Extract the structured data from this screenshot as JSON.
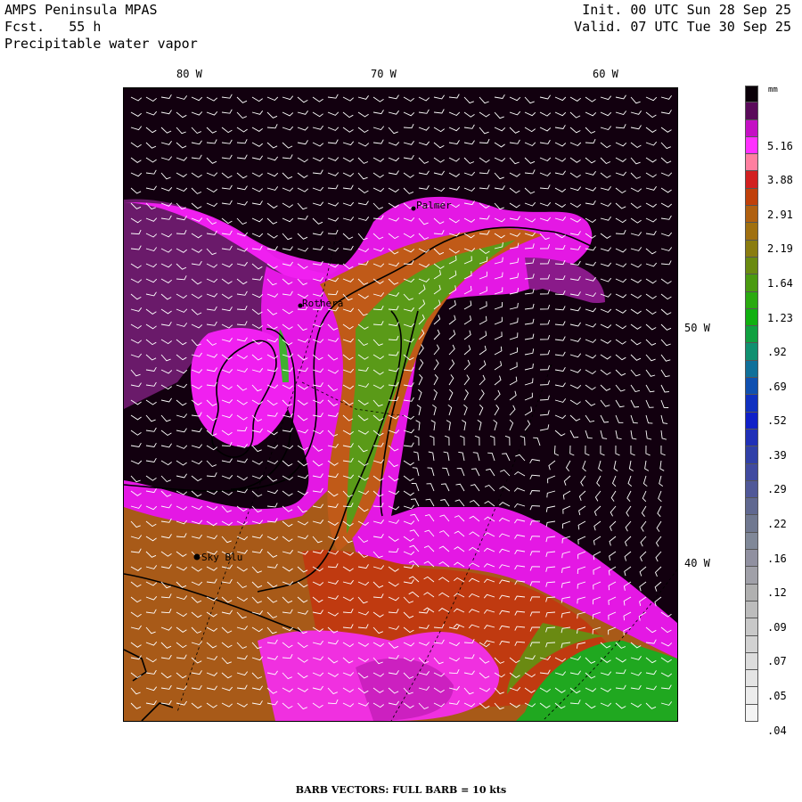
{
  "header": {
    "model": "AMPS Peninsula MPAS",
    "forecast_label": "Fcst.",
    "forecast_hours": "55 h",
    "field": "Precipitable water vapor",
    "init_label": "Init.",
    "init_value": "00 UTC Sun 28 Sep 25",
    "valid_label": "Valid.",
    "valid_value": "07 UTC Tue 30 Sep 25"
  },
  "longitude_labels": [
    "80 W",
    "70 W",
    "60 W"
  ],
  "latitude_labels": [
    "50 W",
    "40 W"
  ],
  "stations": [
    "Palmer",
    "Rothera",
    "Sky Blu"
  ],
  "colorbar": {
    "unit": "mm",
    "colors": [
      "#0a0008",
      "#5a0a5a",
      "#c410c4",
      "#ff30ff",
      "#ff7fa0",
      "#d22020",
      "#c0400a",
      "#b06010",
      "#a07010",
      "#8a7c10",
      "#6a8a10",
      "#4a9a10",
      "#2aaa10",
      "#10b010",
      "#10a040",
      "#109070",
      "#10709a",
      "#1050b0",
      "#1030c0",
      "#1020c8",
      "#2030b8",
      "#3040a8",
      "#404aa0",
      "#505898",
      "#606890",
      "#707890",
      "#808898",
      "#9090a0",
      "#a0a0a8",
      "#b0b0b0",
      "#bcbcbc",
      "#c8c8c8",
      "#d2d2d2",
      "#dcdcdc",
      "#e4e4e4",
      "#ececec",
      "#f4f4f4"
    ],
    "tick_labels": [
      "5.16",
      "3.88",
      "2.91",
      "2.19",
      "1.64",
      "1.23",
      ".92",
      ".69",
      ".52",
      ".39",
      ".29",
      ".22",
      ".16",
      ".12",
      ".09",
      ".07",
      ".05",
      ".04"
    ]
  },
  "footer": "BARB VECTORS:  FULL BARB = 10 kts"
}
